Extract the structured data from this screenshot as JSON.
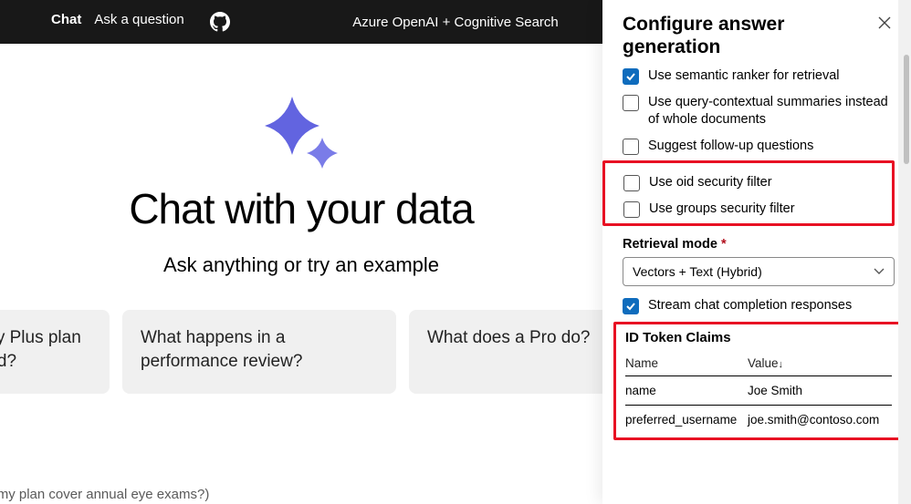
{
  "topbar": {
    "tabs": {
      "chat": "Chat",
      "ask": "Ask a question"
    },
    "brand": "Azure OpenAI + Cognitive Search"
  },
  "main": {
    "heading": "Chat with your data",
    "subheading": "Ask anything or try an example",
    "examples": [
      "my Plus plan ard?",
      "What happens in a performance review?",
      "What does a Pro do?"
    ],
    "input_placeholder": "does my plan cover annual eye exams?)"
  },
  "panel": {
    "title": "Configure answer generation",
    "checkboxes": {
      "semantic_ranker": "Use semantic ranker for retrieval",
      "contextual_summaries": "Use query-contextual summaries instead of whole documents",
      "followup": "Suggest follow-up questions",
      "oid_filter": "Use oid security filter",
      "groups_filter": "Use groups security filter",
      "stream": "Stream chat completion responses"
    },
    "retrieval_label": "Retrieval mode",
    "retrieval_value": "Vectors + Text (Hybrid)",
    "claims": {
      "title": "ID Token Claims",
      "headers": {
        "name": "Name",
        "value": "Value"
      },
      "rows": [
        {
          "name": "name",
          "value": "Joe Smith"
        },
        {
          "name": "preferred_username",
          "value": "joe.smith@contoso.com"
        }
      ]
    }
  }
}
